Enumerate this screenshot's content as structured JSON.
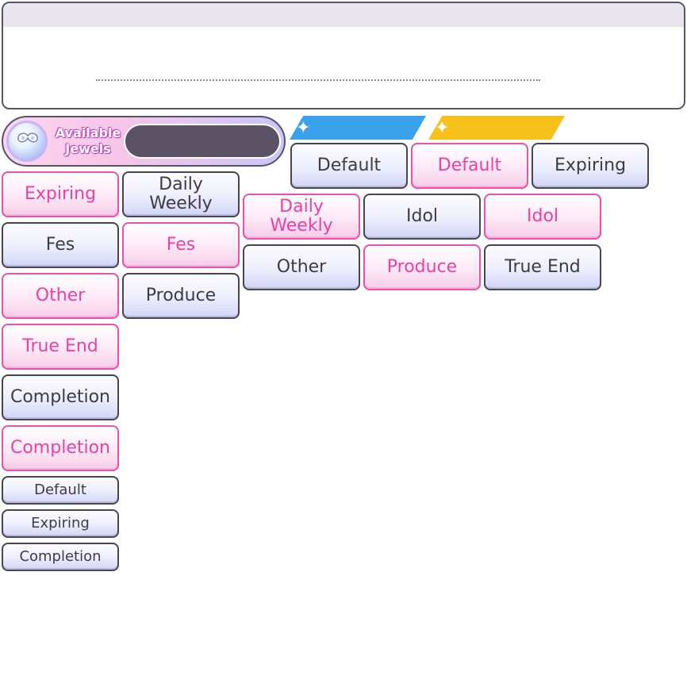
{
  "jewels": {
    "label_line1": "Available",
    "label_line2": "Jewels",
    "icon": "jewel-icon"
  },
  "tags": {
    "blue_icon": "sparkle-icon",
    "yellow_icon": "sparkle-icon",
    "blue_color": "#3aa2ea",
    "yellow_color": "#f7c11c"
  },
  "buttons": {
    "default_std": "Default",
    "default_pink": "Default",
    "expiring_std": "Expiring",
    "expiring_pink": "Expiring",
    "daily_weekly_std_l1": "Daily",
    "daily_weekly_std_l2": "Weekly",
    "daily_weekly_pink_l1": "Daily",
    "daily_weekly_pink_l2": "Weekly",
    "idol_std": "Idol",
    "idol_pink": "Idol",
    "fes_std": "Fes",
    "fes_pink": "Fes",
    "other_std": "Other",
    "other_pink": "Other",
    "produce_std": "Produce",
    "produce_pink": "Produce",
    "true_end_std": "True End",
    "true_end_pink": "True End",
    "completion_std": "Completion",
    "completion_pink": "Completion",
    "small_default": "Default",
    "small_expiring": "Expiring",
    "small_completion": "Completion"
  },
  "colors": {
    "pink_accent": "#ef3fa3",
    "dark_border": "#4a4555"
  }
}
